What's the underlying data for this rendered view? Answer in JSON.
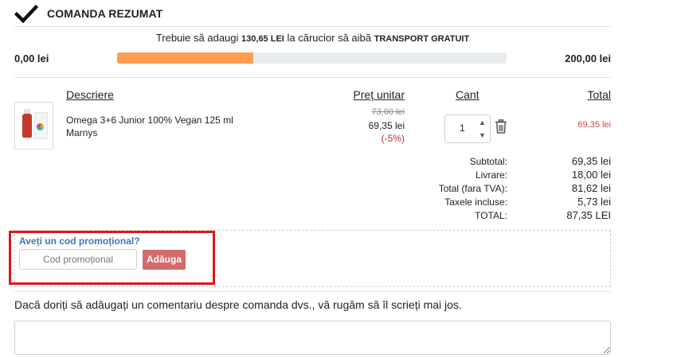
{
  "header": {
    "title": "COMANDA REZUMAT",
    "check_icon": "checkmark-icon"
  },
  "shipping": {
    "message_prefix": "Trebuie să adaugi",
    "amount": "130,65 LEI",
    "message_middle": "la cărucior să aibă",
    "free_label": "TRANSPORT GRATUIT",
    "progress_start": "0,00 lei",
    "progress_end": "200,00 lei",
    "progress_fraction": 0.35,
    "bar_color": "#fd9d4e"
  },
  "table": {
    "headers": {
      "description": "Descriere",
      "unit_price": "Preț unitar",
      "quantity": "Cant",
      "total": "Total"
    },
    "items": [
      {
        "name": "Omega 3+6 Junior 100% Vegan 125 ml",
        "brand": "Marnys",
        "old_price": "73,00 lei",
        "price": "69,35 lei",
        "discount": "(-5%)",
        "quantity": "1",
        "total": "69,35 lei"
      }
    ]
  },
  "summary": {
    "rows": [
      {
        "label": "Subtotal:",
        "value": "69,35 lei"
      },
      {
        "label": "Livrare:",
        "value": "18,00 lei"
      },
      {
        "label": "Total (fara TVA):",
        "value": "81,62 lei"
      },
      {
        "label": "Taxele incluse:",
        "value": "5,73 lei"
      },
      {
        "label": "TOTAL:",
        "value": "87,35 LEI"
      }
    ]
  },
  "promo": {
    "title": "Aveți un cod promoțional?",
    "placeholder": "Cod promoțional",
    "button_label": "Adăuga",
    "highlight_color": "#e3141b"
  },
  "comment": {
    "label": "Dacă doriți să adăugați un comentariu despre comanda dvs., vă rugăm să îl scrieți mai jos.",
    "value": ""
  }
}
